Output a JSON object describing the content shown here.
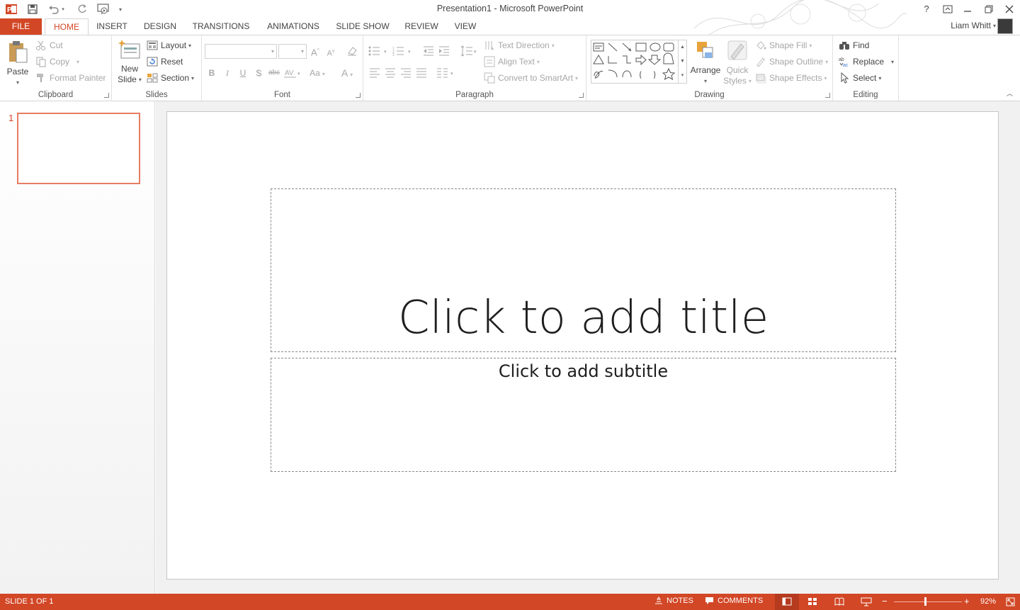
{
  "window": {
    "title": "Presentation1 - Microsoft PowerPoint",
    "user": "Liam Whitt",
    "help": "?"
  },
  "tabs": [
    {
      "label": "FILE"
    },
    {
      "label": "HOME"
    },
    {
      "label": "INSERT"
    },
    {
      "label": "DESIGN"
    },
    {
      "label": "TRANSITIONS"
    },
    {
      "label": "ANIMATIONS"
    },
    {
      "label": "SLIDE SHOW"
    },
    {
      "label": "REVIEW"
    },
    {
      "label": "VIEW"
    }
  ],
  "ribbon": {
    "clipboard": {
      "label": "Clipboard",
      "paste": "Paste",
      "cut": "Cut",
      "copy": "Copy",
      "format_painter": "Format Painter"
    },
    "slides": {
      "label": "Slides",
      "new_slide_1": "New",
      "new_slide_2": "Slide",
      "layout": "Layout",
      "reset": "Reset",
      "section": "Section"
    },
    "font": {
      "label": "Font",
      "bold": "B",
      "italic": "I",
      "underline": "U",
      "shadow": "S",
      "strike": "abc",
      "case": "Aa",
      "grow": "A",
      "shrink": "A",
      "color": "A"
    },
    "paragraph": {
      "label": "Paragraph",
      "text_direction": "Text Direction",
      "align_text": "Align Text",
      "convert_smartart": "Convert to SmartArt"
    },
    "drawing": {
      "label": "Drawing",
      "arrange": "Arrange",
      "quick_styles_1": "Quick",
      "quick_styles_2": "Styles",
      "shape_fill": "Shape Fill",
      "shape_outline": "Shape Outline",
      "shape_effects": "Shape Effects"
    },
    "editing": {
      "label": "Editing",
      "find": "Find",
      "replace": "Replace",
      "select": "Select"
    }
  },
  "thumbnails": [
    {
      "number": "1"
    }
  ],
  "slide": {
    "title_placeholder": "Click to add title",
    "subtitle_placeholder": "Click to add subtitle"
  },
  "status": {
    "slide_info": "SLIDE 1 OF 1",
    "notes": "NOTES",
    "comments": "COMMENTS",
    "zoom": "92%",
    "zoom_level": 0.92
  },
  "colors": {
    "accent": "#d24726",
    "thumb_border": "#e67c62"
  }
}
